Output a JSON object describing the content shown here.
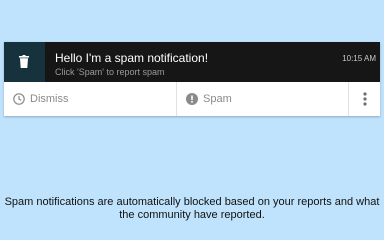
{
  "notification": {
    "title": "Hello I'm a spam notification!",
    "subtitle": "Click 'Spam' to report spam",
    "time": "10:15 AM",
    "icon": "trash-icon"
  },
  "actions": {
    "dismiss_label": "Dismiss",
    "dismiss_icon": "clock-icon",
    "spam_label": "Spam",
    "spam_icon": "alert-icon",
    "more_icon": "more-vertical-icon"
  },
  "footer": {
    "text": "Spam notifications are automatically blocked based on your reports and what the community have reported."
  },
  "colors": {
    "background": "#bfe3fd",
    "notification_bg": "#161616",
    "icon_bg": "#16323d"
  }
}
